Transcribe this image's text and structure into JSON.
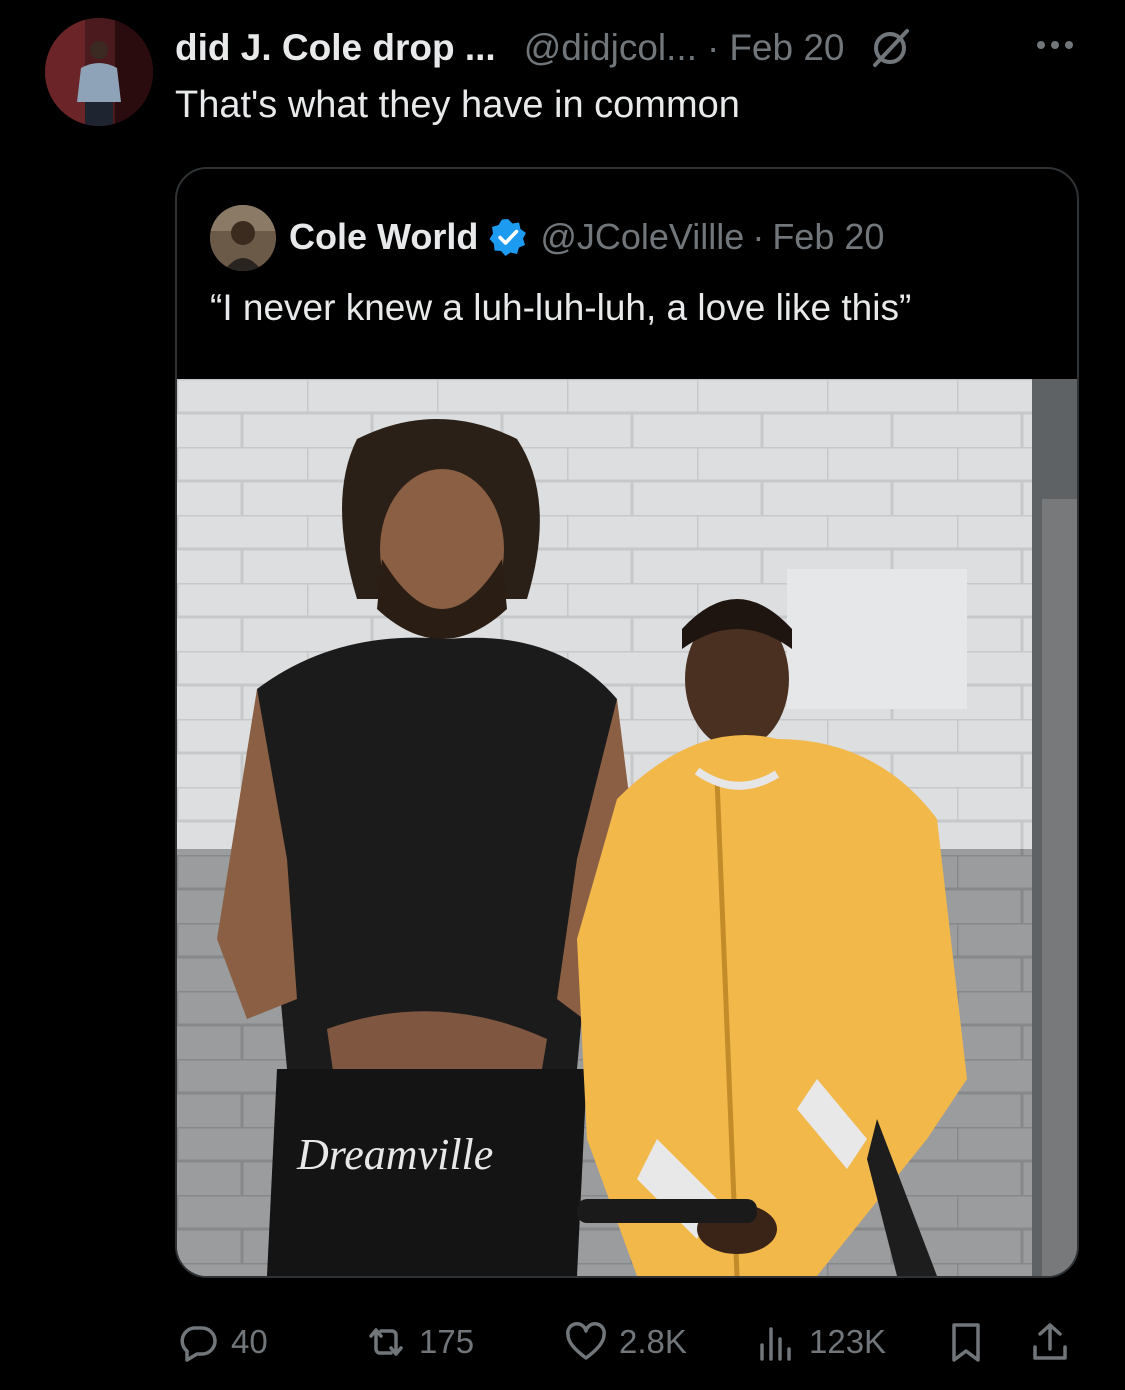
{
  "tweet": {
    "display_name": "did J. Cole drop ...",
    "handle": "@didjcol...",
    "separator": "·",
    "date": "Feb 20",
    "text": "That's what they have in common",
    "more_icon": "more-horizontal-icon",
    "grok_icon": "grok-icon"
  },
  "quoted": {
    "display_name": "Cole World",
    "verified": true,
    "handle": "@JColeVillle",
    "separator": "·",
    "date": "Feb 20",
    "text": "“I never knew a luh-luh-luh, a love like this”",
    "photo_text": "Dreamville"
  },
  "actions": {
    "replies": "40",
    "reposts": "175",
    "likes": "2.8K",
    "views": "123K"
  },
  "colors": {
    "background": "#000000",
    "text": "#e7e9ea",
    "muted": "#71767b",
    "border": "#2f3336",
    "verified": "#1d9bf0"
  }
}
